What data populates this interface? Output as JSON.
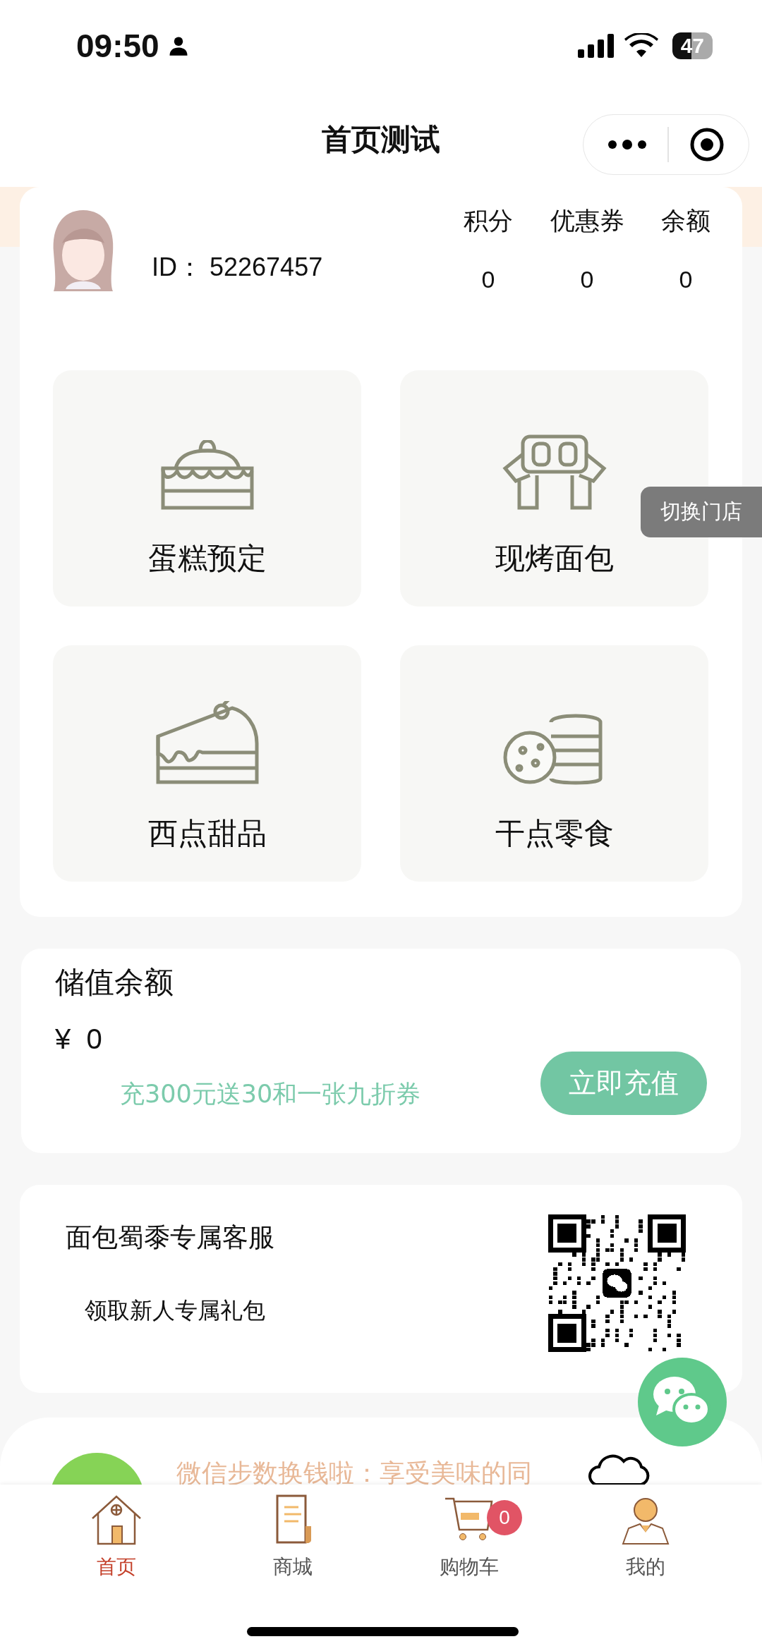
{
  "status_bar": {
    "time": "09:50",
    "battery": "47"
  },
  "nav": {
    "title": "首页测试"
  },
  "user": {
    "id_label": "ID：",
    "id": "52267457",
    "stats": [
      {
        "label": "积分",
        "value": "0"
      },
      {
        "label": "优惠券",
        "value": "0"
      },
      {
        "label": "余额",
        "value": "0"
      }
    ]
  },
  "categories": [
    {
      "label": "蛋糕预定",
      "kind": "cake"
    },
    {
      "label": "现烤面包",
      "kind": "bread"
    },
    {
      "label": "西点甜品",
      "kind": "slice"
    },
    {
      "label": "干点零食",
      "kind": "cookies"
    }
  ],
  "switch_store": "切换门店",
  "balance": {
    "title": "储值余额",
    "currency": "¥",
    "amount": "0",
    "promo": "充300元送30和一张九折券",
    "button": "立即充值"
  },
  "service": {
    "title": "面包蜀黍专属客服",
    "subtitle": "领取新人专属礼包"
  },
  "steps_banner": {
    "text": "微信步数换钱啦：享受美味的同"
  },
  "tabs": [
    {
      "label": "首页",
      "kind": "home",
      "selected": true
    },
    {
      "label": "商城",
      "kind": "shop",
      "selected": false
    },
    {
      "label": "购物车",
      "kind": "cart",
      "selected": false,
      "badge": "0"
    },
    {
      "label": "我的",
      "kind": "me",
      "selected": false
    }
  ]
}
